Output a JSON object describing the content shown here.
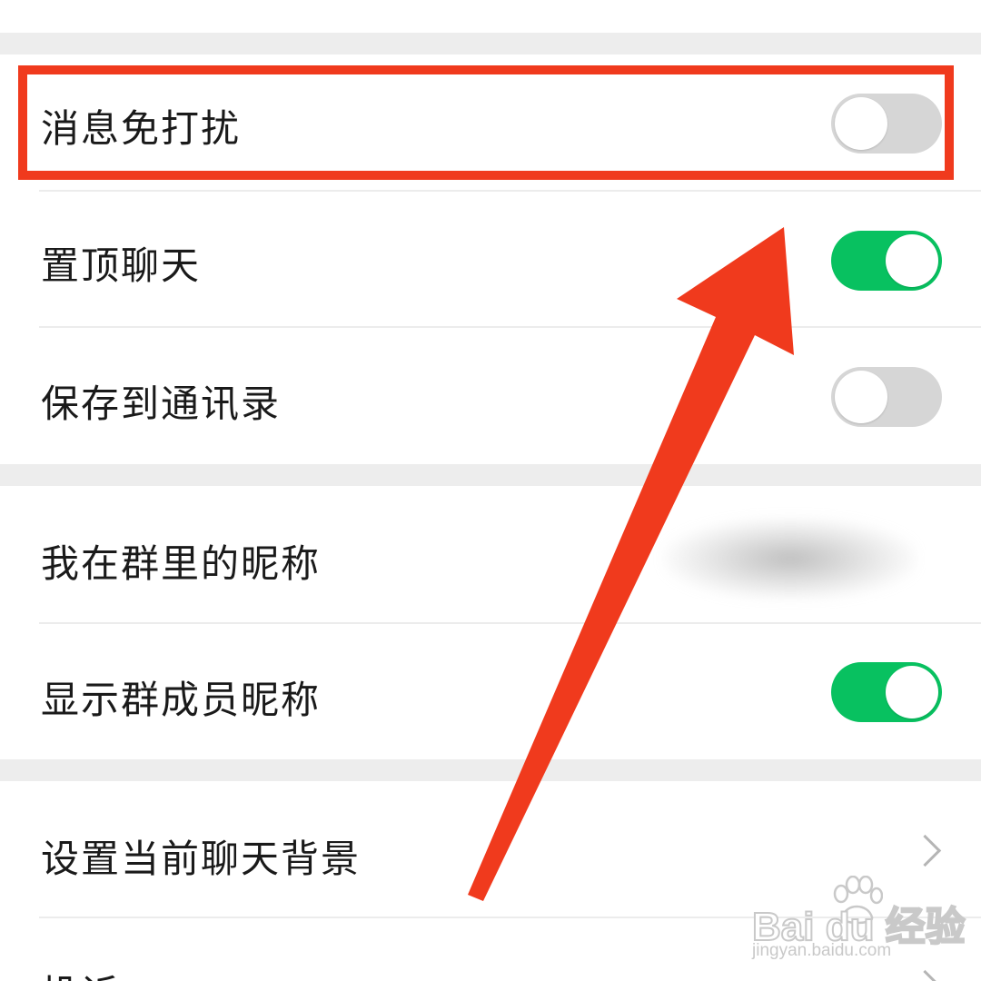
{
  "settings": {
    "mute_notifications": {
      "label": "消息免打扰",
      "on": false
    },
    "sticky_on_top": {
      "label": "置顶聊天",
      "on": true
    },
    "save_to_contacts": {
      "label": "保存到通讯录",
      "on": false
    },
    "my_group_alias": {
      "label": "我在群里的昵称"
    },
    "show_member_nicknames": {
      "label": "显示群成员昵称",
      "on": true
    },
    "chat_background": {
      "label": "设置当前聊天背景"
    },
    "report": {
      "label": "投诉"
    }
  },
  "colors": {
    "toggle_on": "#08c160",
    "toggle_off": "#d6d6d6",
    "annotation": "#f03a1d",
    "section_gap": "#ededed"
  },
  "watermark": {
    "brand": "Bai du 经验",
    "url": "jingyan.baidu.com"
  },
  "icons": [
    "chevron-right-icon",
    "paw-icon"
  ]
}
